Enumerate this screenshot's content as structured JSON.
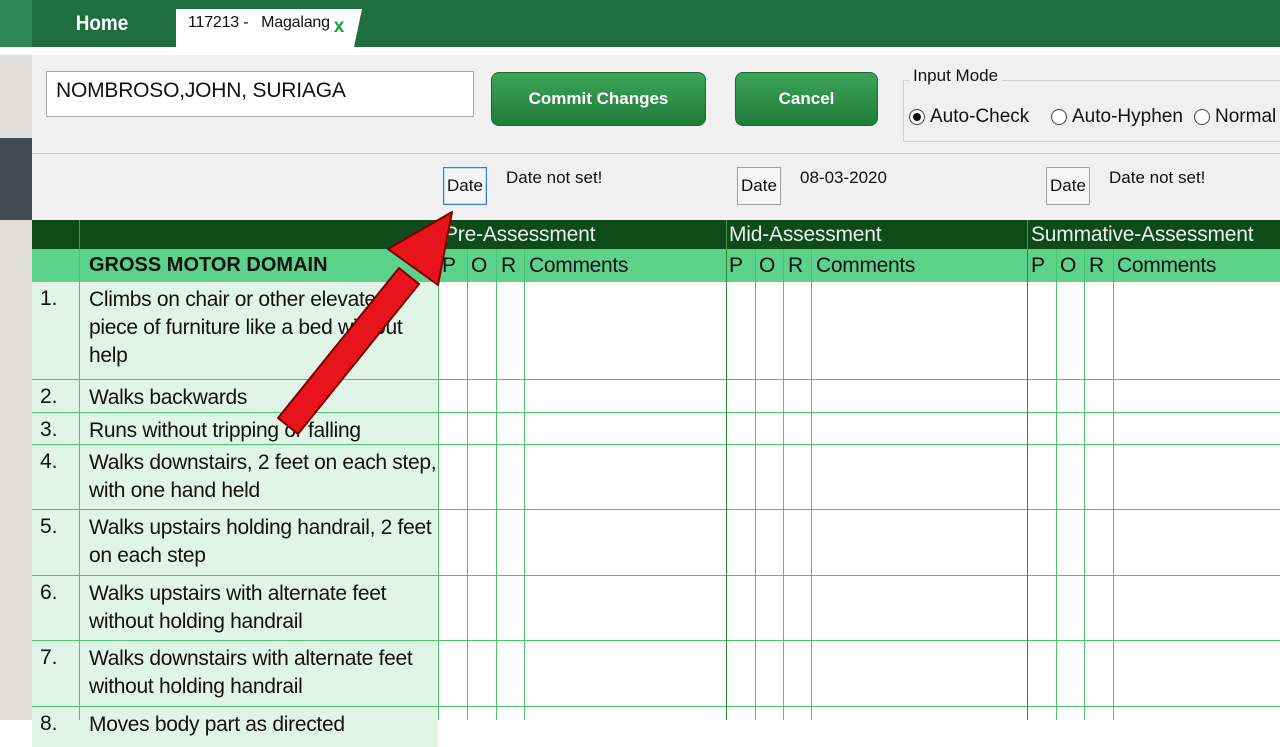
{
  "tabs": {
    "home_label": "Home",
    "doc_label": "117213 -   Magalang",
    "doc_close": "x"
  },
  "form": {
    "student_name": "NOMBROSO,JOHN, SURIAGA",
    "commit_label": "Commit Changes",
    "cancel_label": "Cancel",
    "input_mode_title": "Input Mode",
    "modes": [
      "Auto-Check",
      "Auto-Hyphen",
      "Normal"
    ],
    "selected_mode": "Auto-Check"
  },
  "dates": {
    "button_label": "Date",
    "pre": "Date not set!",
    "mid": "08-03-2020",
    "summative": "Date not set!"
  },
  "grid": {
    "groups": [
      "Pre-Assessment",
      "Mid-Assessment",
      "Summative-Assessment"
    ],
    "domain_header": "GROSS MOTOR DOMAIN",
    "subcols": [
      "P",
      "O",
      "R",
      "Comments"
    ],
    "rows": [
      {
        "num": "1.",
        "text": "Climbs on chair or other elevated piece of furniture like a bed without help"
      },
      {
        "num": "2.",
        "text": "Walks backwards"
      },
      {
        "num": "3.",
        "text": "Runs without tripping or falling"
      },
      {
        "num": "4.",
        "text": "Walks downstairs, 2 feet on each step, with one hand held"
      },
      {
        "num": "5.",
        "text": "Walks upstairs holding handrail, 2 feet on each step"
      },
      {
        "num": "6.",
        "text": "Walks upstairs with alternate feet without holding handrail"
      },
      {
        "num": "7.",
        "text": "Walks downstairs with alternate feet without holding handrail"
      },
      {
        "num": "8.",
        "text": "Moves body part as directed"
      }
    ]
  },
  "colors": {
    "header_dark": "#0f4a1b",
    "header_light": "#5dd28a",
    "row_fill": "#e0f5e8",
    "grid_line": "#49c66a",
    "annotation_arrow": "#e8141c"
  }
}
